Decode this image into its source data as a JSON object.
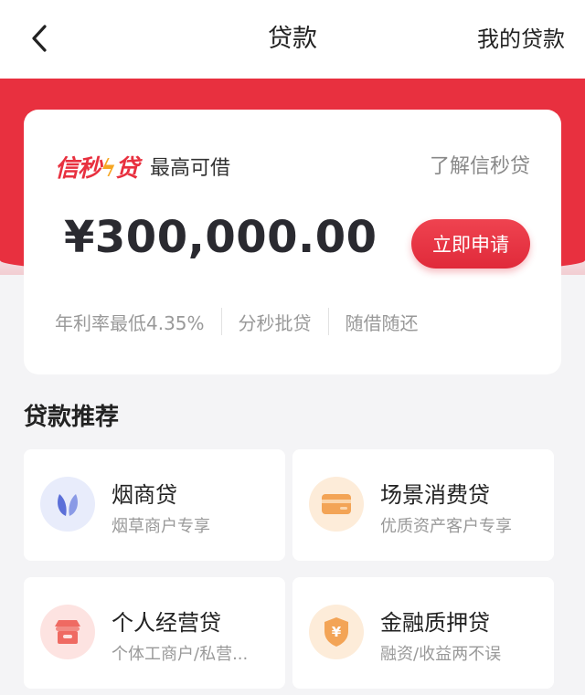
{
  "nav": {
    "back_icon": "chevron-left-icon",
    "title": "贷款",
    "right_link": "我的贷款"
  },
  "hero": {
    "brand_part1": "信秒",
    "brand_part2": "贷",
    "tag": "最高可借",
    "learn_link": "了解信秒贷",
    "amount": "¥300,000.00",
    "apply_label": "立即申请",
    "features": [
      "年利率最低4.35%",
      "分秒批贷",
      "随借随还"
    ]
  },
  "section": {
    "title": "贷款推荐"
  },
  "products": [
    {
      "name": "烟商贷",
      "subtitle": "烟草商户专享",
      "icon": "leaf-icon"
    },
    {
      "name": "场景消费贷",
      "subtitle": "优质资产客户专享",
      "icon": "card-icon"
    },
    {
      "name": "个人经营贷",
      "subtitle": "个体工商户/私营...",
      "icon": "shop-icon"
    },
    {
      "name": "金融质押贷",
      "subtitle": "融资/收益两不误",
      "icon": "shield-yen-icon"
    }
  ],
  "colors": {
    "brand_red": "#e8303f",
    "accent_orange": "#f6a623",
    "page_bg": "#f4f4f6"
  }
}
